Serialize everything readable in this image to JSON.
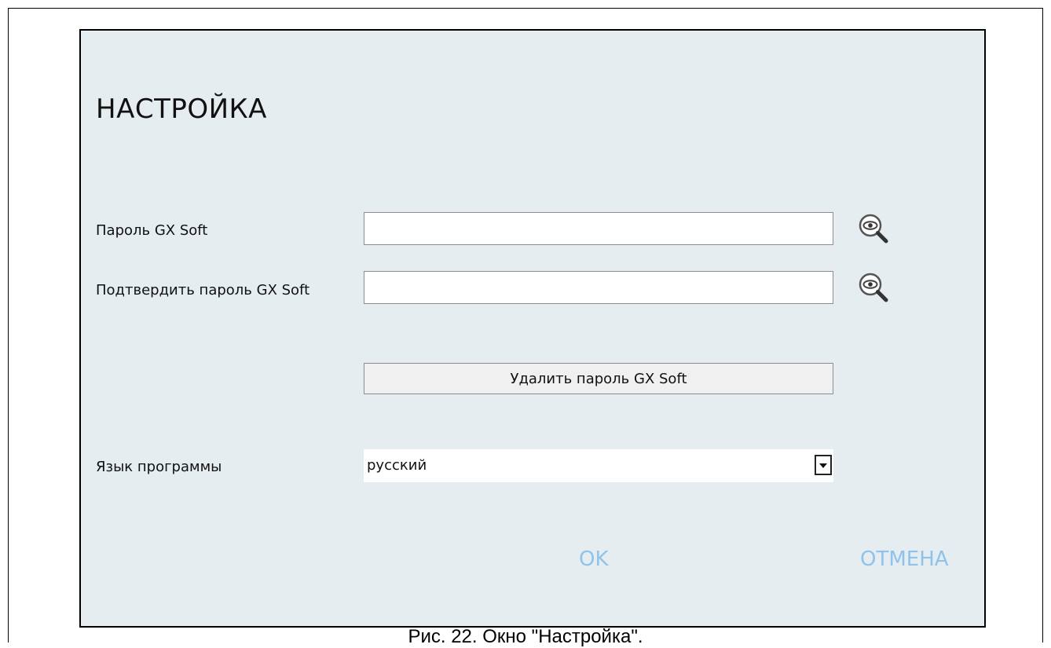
{
  "dialog": {
    "title": "НАСТРОЙКА",
    "password_label": "Пароль GX Soft",
    "password_value": "",
    "password_show_icon": "eye-magnifier-icon",
    "confirm_label": "Подтвердить пароль GX Soft",
    "confirm_value": "",
    "confirm_show_icon": "eye-magnifier-icon",
    "delete_button_label": "Удалить пароль GX Soft",
    "language_label": "Язык программы",
    "language_value": "русский",
    "ok_label": "OK",
    "cancel_label": "ОТМЕНА"
  },
  "caption": "Рис. 22. Окно \"Настройка\".",
  "colors": {
    "dialog_background": "#e6edf0",
    "footer_button_text": "#8fc3ec"
  }
}
